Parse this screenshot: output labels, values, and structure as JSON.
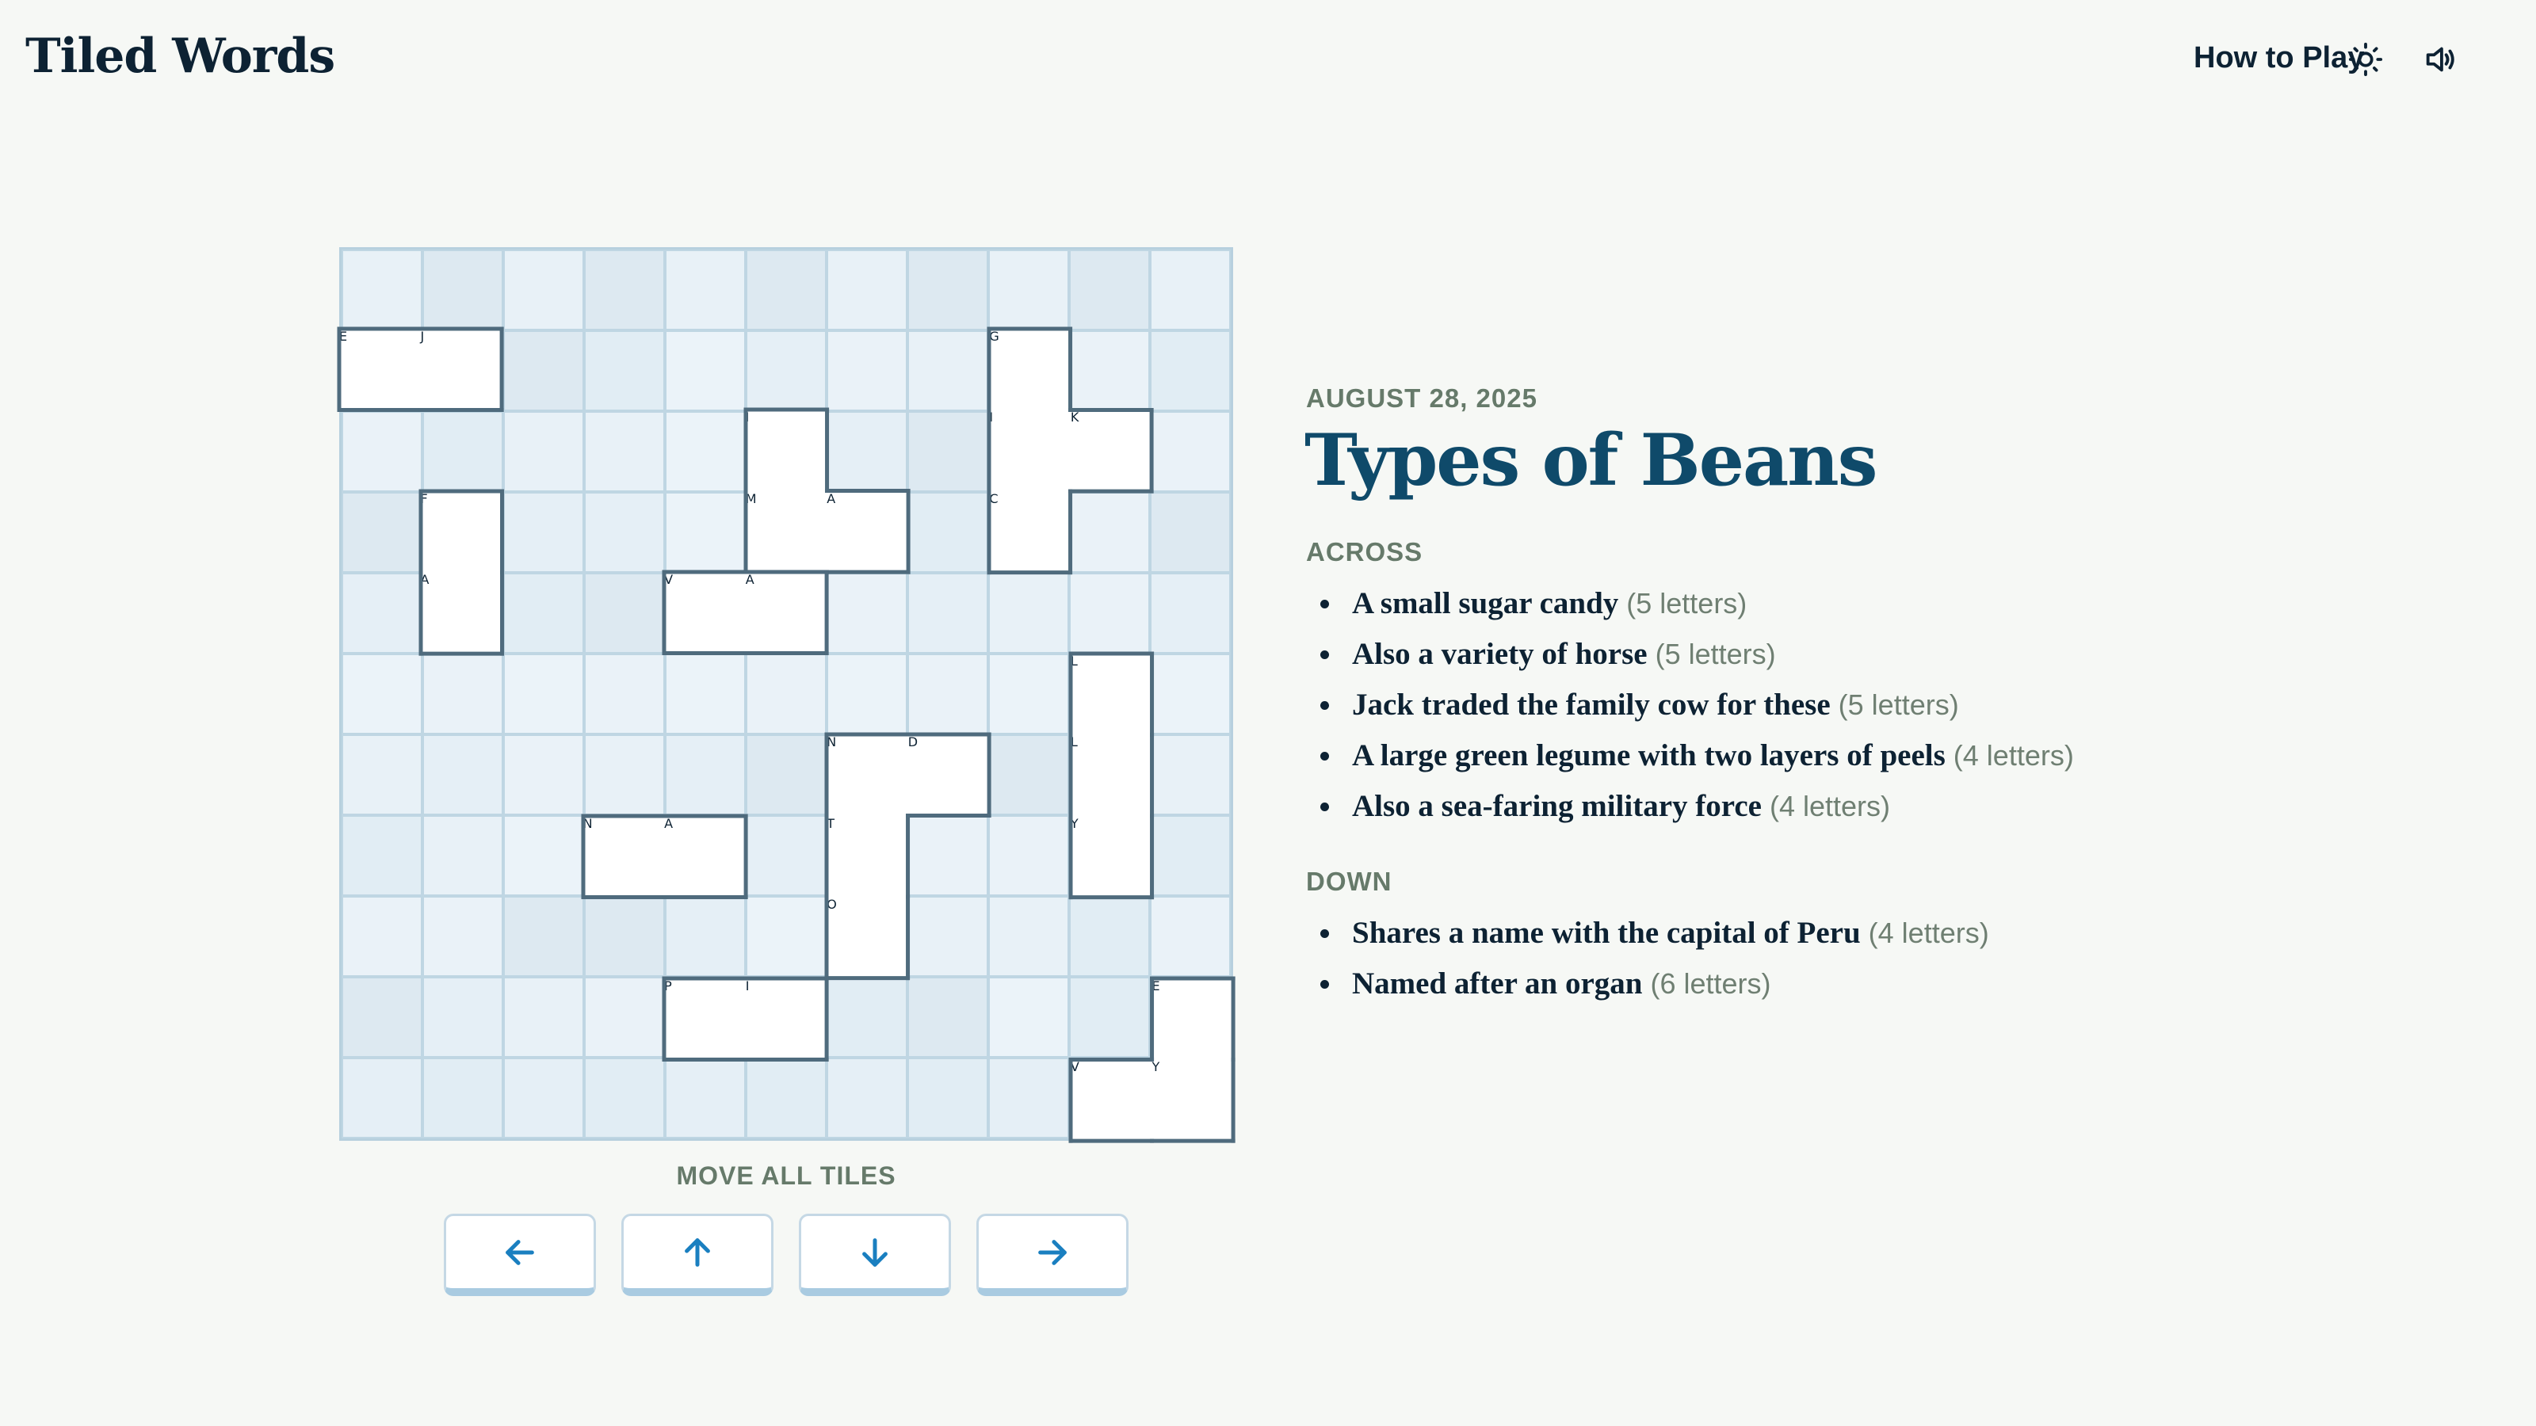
{
  "header": {
    "app_title": "Tiled Words",
    "how_to_play": "How to Play",
    "icons": [
      "sun-icon",
      "sound-icon"
    ]
  },
  "board": {
    "rows": 11,
    "cols": 11,
    "tiles": [
      {
        "id": "tile-ej",
        "cells": [
          [
            1,
            0,
            "E"
          ],
          [
            1,
            1,
            "J"
          ]
        ]
      },
      {
        "id": "tile-fa",
        "cells": [
          [
            3,
            1,
            "F"
          ],
          [
            4,
            1,
            "A"
          ]
        ]
      },
      {
        "id": "tile-ima",
        "cells": [
          [
            2,
            5,
            "I"
          ],
          [
            3,
            5,
            "M"
          ],
          [
            3,
            6,
            "A"
          ]
        ]
      },
      {
        "id": "tile-va",
        "cells": [
          [
            4,
            4,
            "V"
          ],
          [
            4,
            5,
            "A"
          ]
        ]
      },
      {
        "id": "tile-gick",
        "cells": [
          [
            1,
            8,
            "G"
          ],
          [
            2,
            8,
            "I"
          ],
          [
            3,
            8,
            "C"
          ],
          [
            2,
            9,
            "K"
          ]
        ]
      },
      {
        "id": "tile-lly",
        "cells": [
          [
            5,
            9,
            "L"
          ],
          [
            6,
            9,
            "L"
          ],
          [
            7,
            9,
            "Y"
          ]
        ]
      },
      {
        "id": "tile-ndto",
        "cells": [
          [
            6,
            6,
            "N"
          ],
          [
            6,
            7,
            "D"
          ],
          [
            7,
            6,
            "T"
          ],
          [
            8,
            6,
            "O"
          ]
        ]
      },
      {
        "id": "tile-na",
        "cells": [
          [
            7,
            3,
            "N"
          ],
          [
            7,
            4,
            "A"
          ]
        ]
      },
      {
        "id": "tile-pi",
        "cells": [
          [
            9,
            4,
            "P"
          ],
          [
            9,
            5,
            "I"
          ]
        ]
      },
      {
        "id": "tile-evy",
        "cells": [
          [
            9,
            10,
            "E"
          ],
          [
            10,
            9,
            "V"
          ],
          [
            10,
            10,
            "Y"
          ]
        ]
      }
    ]
  },
  "controls": {
    "label": "MOVE ALL TILES",
    "buttons": [
      "left",
      "up",
      "down",
      "right"
    ]
  },
  "puzzle": {
    "date": "AUGUST 28, 2025",
    "title": "Types of Beans",
    "across_label": "ACROSS",
    "down_label": "DOWN",
    "across": [
      {
        "text": "A small sugar candy",
        "length": "(5 letters)"
      },
      {
        "text": "Also a variety of horse",
        "length": "(5 letters)"
      },
      {
        "text": "Jack traded the family cow for these",
        "length": "(5 letters)"
      },
      {
        "text": "A large green legume with two layers of peels",
        "length": "(4 letters)"
      },
      {
        "text": "Also a sea-faring military force",
        "length": "(4 letters)"
      }
    ],
    "down": [
      {
        "text": "Shares a name with the capital of Peru",
        "length": "(4 letters)"
      },
      {
        "text": "Named after an organ",
        "length": "(6 letters)"
      }
    ]
  },
  "colors": {
    "accent": "#1a7fc0",
    "title": "#0f4a6a",
    "tile_border": "#4f6b7d",
    "label": "#667a6a"
  }
}
